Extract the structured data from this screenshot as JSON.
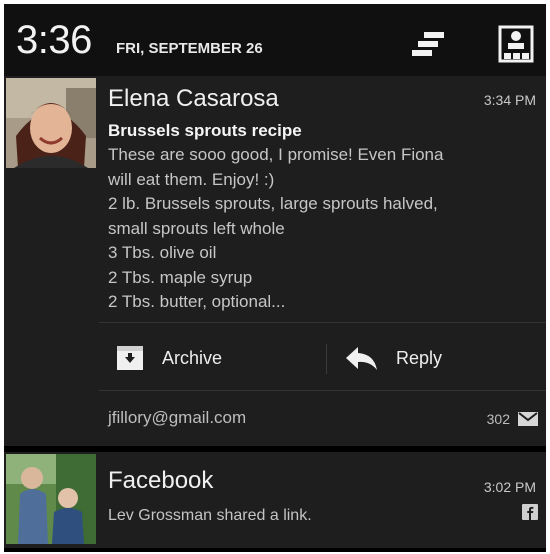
{
  "status_bar": {
    "time": "3:36",
    "date": "FRI, SEPTEMBER 26",
    "sort_icon": "notification-sort-icon",
    "quick_settings_icon": "quick-settings-icon"
  },
  "notifications": [
    {
      "sender": "Elena Casarosa",
      "time": "3:34 PM",
      "subject": "Brussels sprouts recipe",
      "body_lines": [
        "These are sooo good, I promise! Even Fiona",
        "will eat them. Enjoy! :)",
        "2 lb. Brussels sprouts, large sprouts halved,",
        "small sprouts left whole",
        "3 Tbs. olive oil",
        "2 Tbs. maple syrup",
        "2 Tbs. butter, optional..."
      ],
      "actions": [
        {
          "label": "Archive",
          "icon": "archive-icon"
        },
        {
          "label": "Reply",
          "icon": "reply-icon"
        }
      ],
      "account": "jfillory@gmail.com",
      "count": "302",
      "app_icon": "gmail-icon"
    },
    {
      "sender": "Facebook",
      "time": "3:02 PM",
      "text": "Lev Grossman shared a link.",
      "app_icon": "facebook-icon"
    }
  ],
  "colors": {
    "background": "#000000",
    "card": "#1e1e1e",
    "header": "#101010",
    "primary_text": "#f0f0f0",
    "secondary_text": "#c6c6c6"
  }
}
